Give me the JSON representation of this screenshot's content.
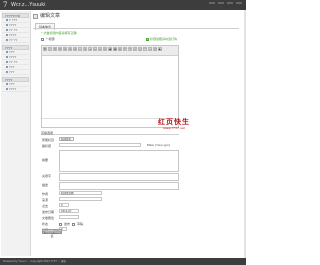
{
  "app": {
    "logo": "7",
    "title": "Wcr.z...Ysuuki",
    "top_links": [
      "",
      "",
      "",
      ""
    ]
  },
  "sidebar": {
    "groups": [
      {
        "head": "YYYTYYYR",
        "items": [
          "Y YYY",
          "YYYY",
          "YY YY",
          "YYYY",
          "YY YY"
        ]
      },
      {
        "head": "YYYY",
        "items": [
          "YYY",
          "YYYY",
          "YY YY",
          "YYY",
          "YYY"
        ]
      },
      {
        "head": "YYYY",
        "items": [
          "YYY",
          "YYYY"
        ]
      }
    ]
  },
  "page": {
    "title": "编辑文章",
    "tab": "基本信息"
  },
  "note": "* 文章标题内容请填写正确",
  "title_row": {
    "label": "* 标题",
    "remind_link": "标题加粗请勾选打钩"
  },
  "watermark": {
    "text": "红页快生",
    "url": "www.7737.net"
  },
  "form": {
    "section_head": "高级选项",
    "fields": [
      {
        "label": "所属栏目",
        "select": "新闻资讯"
      },
      {
        "label": "副标题",
        "value": ""
      },
      {
        "label": "摘要",
        "value": ""
      },
      {
        "label": "关键字",
        "value": ""
      },
      {
        "label": "描述",
        "value": ""
      },
      {
        "label": "作者",
        "value": "新闻资讯网"
      },
      {
        "label": "来源",
        "value": ""
      },
      {
        "label": "点击",
        "value": "0"
      },
      {
        "label": "发布日期",
        "value": "2014-07"
      },
      {
        "label": "文章属性",
        "value": ""
      },
      {
        "label": "状态",
        "options": [
          "发布",
          "草稿"
        ]
      },
      {
        "label": "排序",
        "value": "0"
      }
    ],
    "hint": "Maxi (Ysuu jpn)",
    "submit": "保存并返回列表"
  },
  "footer": "Powered by Ysuu.z ... Copyright 2014 7737 ... 帮助"
}
